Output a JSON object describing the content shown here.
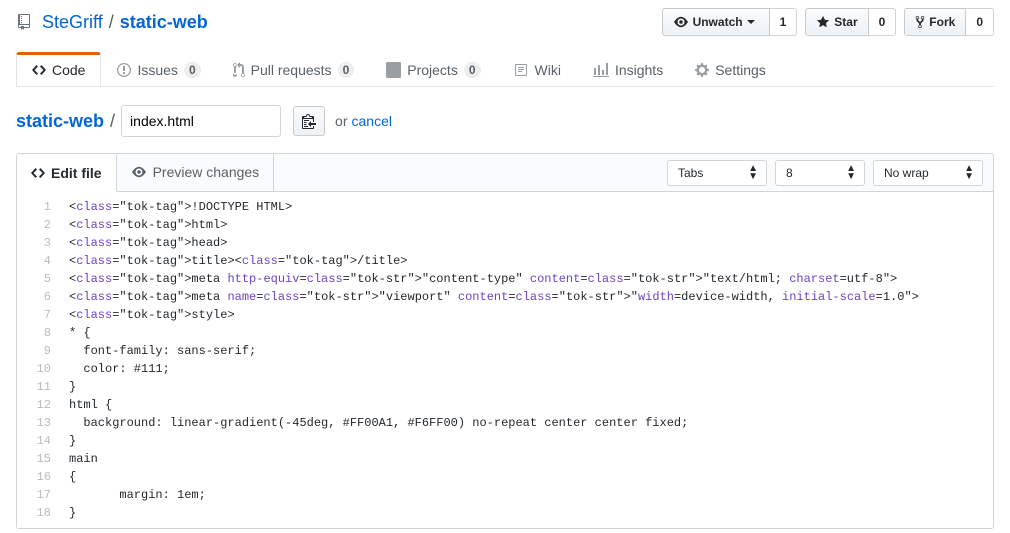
{
  "header": {
    "owner": "SteGriff",
    "repo": "static-web",
    "actions": {
      "watch": {
        "label": "Unwatch",
        "count": "1"
      },
      "star": {
        "label": "Star",
        "count": "0"
      },
      "fork": {
        "label": "Fork",
        "count": "0"
      }
    }
  },
  "tabs": {
    "code": "Code",
    "issues": {
      "label": "Issues",
      "count": "0"
    },
    "pulls": {
      "label": "Pull requests",
      "count": "0"
    },
    "projects": {
      "label": "Projects",
      "count": "0"
    },
    "wiki": "Wiki",
    "insights": "Insights",
    "settings": "Settings"
  },
  "breadcrumb": {
    "root": "static-web",
    "filename": "index.html",
    "or": "or",
    "cancel": "cancel"
  },
  "editor": {
    "tabs": {
      "edit": "Edit file",
      "preview": "Preview changes"
    },
    "indent_mode": "Tabs",
    "indent_size": "8",
    "wrap_mode": "No wrap"
  },
  "code": {
    "line_numbers": [
      "1",
      "2",
      "3",
      "4",
      "5",
      "6",
      "7",
      "8",
      "9",
      "10",
      "11",
      "12",
      "13",
      "14",
      "15",
      "16",
      "17",
      "18"
    ],
    "lines": [
      "<!DOCTYPE HTML>",
      "<html>",
      "<head>",
      "<title></title>",
      "<meta http-equiv=\"content-type\" content=\"text/html; charset=utf-8\">",
      "<meta name=\"viewport\" content=\"width=device-width, initial-scale=1.0\">",
      "<style>",
      "* {",
      "  font-family: sans-serif;",
      "  color: #111;",
      "}",
      "html {",
      "  background: linear-gradient(-45deg, #FF00A1, #F6FF00) no-repeat center center fixed;",
      "}",
      "main",
      "{",
      "       margin: 1em;",
      "}"
    ]
  }
}
